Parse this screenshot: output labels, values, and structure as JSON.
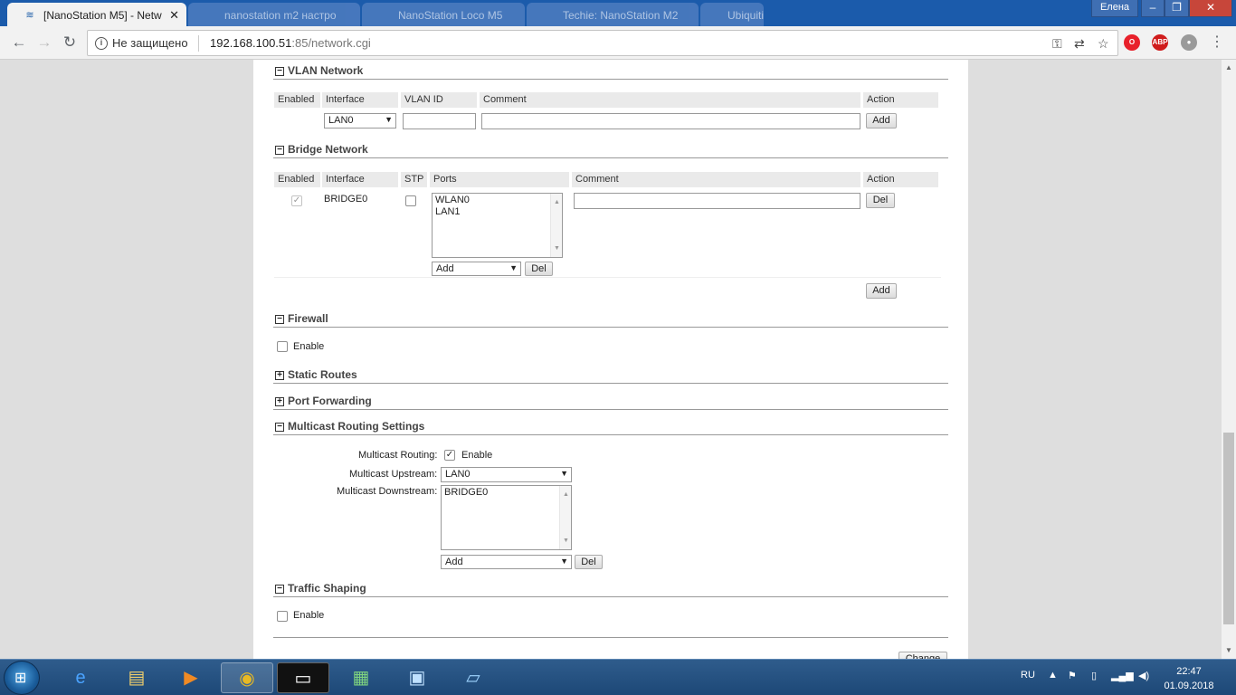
{
  "browser": {
    "active_tab_title": "[NanoStation M5] - Netw",
    "bg_tabs": [
      "nanostation m2 настро",
      "NanoStation Loco M5",
      "Techie: NanoStation M2",
      "Ubiquiti"
    ],
    "user_badge": "Елена",
    "window_controls": {
      "minimize": "–",
      "maximize": "❐",
      "close": "✕"
    },
    "security_label": "Не защищено",
    "url_host": "192.168.100.51",
    "url_rest": ":85/network.cgi",
    "ext_opera": "O",
    "ext_abp": "ABP"
  },
  "vlan": {
    "title": "VLAN Network",
    "toggle": "−",
    "headers": [
      "Enabled",
      "Interface",
      "VLAN ID",
      "Comment",
      "Action"
    ],
    "interface_value": "LAN0",
    "add_label": "Add"
  },
  "bridge": {
    "title": "Bridge Network",
    "toggle": "−",
    "headers": [
      "Enabled",
      "Interface",
      "STP",
      "Ports",
      "Comment",
      "Action"
    ],
    "row": {
      "interface": "BRIDGE0",
      "ports": [
        "WLAN0",
        "LAN1"
      ],
      "port_select": "Add",
      "port_del": "Del",
      "del_label": "Del"
    },
    "add_label": "Add"
  },
  "firewall": {
    "title": "Firewall",
    "toggle": "−",
    "enable_label": "Enable"
  },
  "static_routes": {
    "title": "Static Routes",
    "toggle": "+"
  },
  "port_forwarding": {
    "title": "Port Forwarding",
    "toggle": "+"
  },
  "multicast": {
    "title": "Multicast Routing Settings",
    "toggle": "−",
    "routing_label": "Multicast Routing:",
    "routing_enable": "Enable",
    "upstream_label": "Multicast Upstream:",
    "upstream_value": "LAN0",
    "downstream_label": "Multicast Downstream:",
    "downstream_items": [
      "BRIDGE0"
    ],
    "downstream_select": "Add",
    "downstream_del": "Del"
  },
  "traffic": {
    "title": "Traffic Shaping",
    "toggle": "−",
    "enable_label": "Enable"
  },
  "change_button": "Change",
  "taskbar": {
    "lang": "RU",
    "time": "22:47",
    "date": "01.09.2018"
  }
}
